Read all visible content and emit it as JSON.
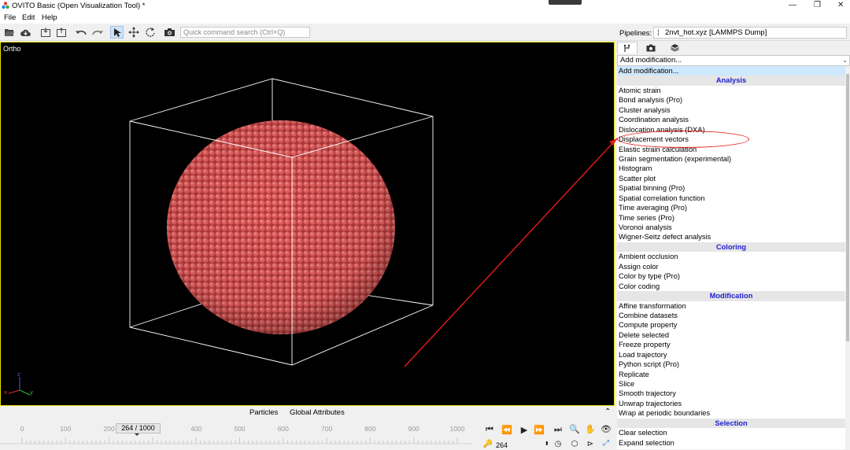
{
  "window": {
    "title": "OVITO Basic (Open Visualization Tool) *",
    "minimize": "—",
    "restore": "❐",
    "close": "✕"
  },
  "menu": {
    "file": "File",
    "edit": "Edit",
    "help": "Help"
  },
  "toolbar": {
    "icons": [
      "open-folder-icon",
      "cloud-icon",
      "import-icon",
      "export-icon",
      "undo-icon",
      "redo-icon",
      "select-icon",
      "move-icon",
      "rotate-icon",
      "camera-icon"
    ],
    "search_placeholder": "Quick command search (Ctrl+Q)"
  },
  "pipelines": {
    "label": "Pipelines:",
    "selected": "2nvt_hot.xyz [LAMMPS Dump]"
  },
  "viewport": {
    "label": "Ortho",
    "particle_color": "#e05555",
    "border_color": "#e8e000",
    "axes": {
      "x": "x",
      "y": "y",
      "z": "z"
    }
  },
  "bottom_tabs": [
    "Particles",
    "Global Attributes"
  ],
  "timeline": {
    "ticks": [
      "0",
      "100",
      "200",
      "300",
      "400",
      "500",
      "600",
      "700",
      "800",
      "900",
      "1000"
    ],
    "current_frame_label": "264 / 1000",
    "current_frame": 264,
    "max_frame": 1000
  },
  "animation": {
    "frame_value": "264"
  },
  "right_panel": {
    "add_modification_label": "Add modification...",
    "list": [
      {
        "text": "Add modification...",
        "kind": "selected"
      },
      {
        "text": "Analysis",
        "kind": "category"
      },
      {
        "text": "Atomic strain",
        "kind": "item"
      },
      {
        "text": "Bond analysis (Pro)",
        "kind": "item"
      },
      {
        "text": "Cluster analysis",
        "kind": "item"
      },
      {
        "text": "Coordination analysis",
        "kind": "item"
      },
      {
        "text": "Dislocation analysis (DXA)",
        "kind": "item"
      },
      {
        "text": "Displacement vectors",
        "kind": "item"
      },
      {
        "text": "Elastic strain calculation",
        "kind": "item"
      },
      {
        "text": "Grain segmentation (experimental)",
        "kind": "item"
      },
      {
        "text": "Histogram",
        "kind": "item"
      },
      {
        "text": "Scatter plot",
        "kind": "item"
      },
      {
        "text": "Spatial binning (Pro)",
        "kind": "item"
      },
      {
        "text": "Spatial correlation function",
        "kind": "item"
      },
      {
        "text": "Time averaging (Pro)",
        "kind": "item"
      },
      {
        "text": "Time series (Pro)",
        "kind": "item"
      },
      {
        "text": "Voronoi analysis",
        "kind": "item"
      },
      {
        "text": "Wigner-Seitz defect analysis",
        "kind": "item"
      },
      {
        "text": "Coloring",
        "kind": "category"
      },
      {
        "text": "Ambient occlusion",
        "kind": "item"
      },
      {
        "text": "Assign color",
        "kind": "item"
      },
      {
        "text": "Color by type (Pro)",
        "kind": "item"
      },
      {
        "text": "Color coding",
        "kind": "item"
      },
      {
        "text": "Modification",
        "kind": "category"
      },
      {
        "text": "Affine transformation",
        "kind": "item"
      },
      {
        "text": "Combine datasets",
        "kind": "item"
      },
      {
        "text": "Compute property",
        "kind": "item"
      },
      {
        "text": "Delete selected",
        "kind": "item"
      },
      {
        "text": "Freeze property",
        "kind": "item"
      },
      {
        "text": "Load trajectory",
        "kind": "item"
      },
      {
        "text": "Python script (Pro)",
        "kind": "item"
      },
      {
        "text": "Replicate",
        "kind": "item"
      },
      {
        "text": "Slice",
        "kind": "item"
      },
      {
        "text": "Smooth trajectory",
        "kind": "item"
      },
      {
        "text": "Unwrap trajectories",
        "kind": "item"
      },
      {
        "text": "Wrap at periodic boundaries",
        "kind": "item"
      },
      {
        "text": "Selection",
        "kind": "category"
      },
      {
        "text": "Clear selection",
        "kind": "item"
      },
      {
        "text": "Expand selection",
        "kind": "item"
      }
    ]
  },
  "annotation": {
    "color": "#e41b1b"
  }
}
